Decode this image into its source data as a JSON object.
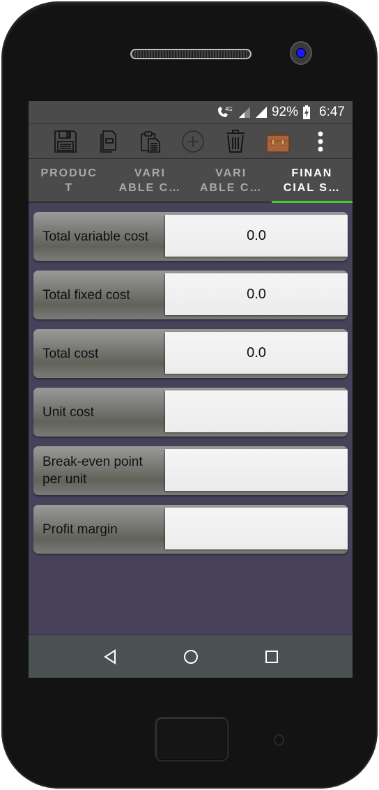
{
  "device": {
    "frame_color": "#131313",
    "camera_color": "#1a1aff"
  },
  "status_bar": {
    "network": "4G",
    "battery_percent": "92%",
    "time": "6:47",
    "icons": [
      "call-4g-icon",
      "signal-weak-icon",
      "signal-full-icon",
      "battery-charging-icon"
    ]
  },
  "toolbar": {
    "buttons": [
      {
        "name": "save",
        "icon": "floppy-disk-icon"
      },
      {
        "name": "copy",
        "icon": "copy-document-icon"
      },
      {
        "name": "paste",
        "icon": "clipboard-paste-icon"
      },
      {
        "name": "add",
        "icon": "plus-circle-icon"
      },
      {
        "name": "delete",
        "icon": "trash-icon"
      },
      {
        "name": "briefcase",
        "icon": "briefcase-icon"
      },
      {
        "name": "more",
        "icon": "more-vertical-icon"
      }
    ]
  },
  "tabs": [
    {
      "line1": "PRODUC",
      "line2": "T",
      "active": false
    },
    {
      "line1": "VARI",
      "line2": "ABLE C…",
      "active": false
    },
    {
      "line1": "VARI",
      "line2": "ABLE C…",
      "active": false
    },
    {
      "line1": "FINAN",
      "line2": "CIAL S…",
      "active": true
    }
  ],
  "accent_color": "#3ccf2e",
  "financial_summary": {
    "rows": [
      {
        "label": "Total variable cost",
        "value": "0.0"
      },
      {
        "label": "Total fixed cost",
        "value": "0.0"
      },
      {
        "label": "Total cost",
        "value": "0.0"
      },
      {
        "label": "Unit cost",
        "value": ""
      },
      {
        "label": "Break-even point per unit",
        "value": ""
      },
      {
        "label": "Profit margin",
        "value": ""
      }
    ]
  },
  "nav_bar": {
    "buttons": [
      "back-icon",
      "home-icon",
      "recents-icon"
    ]
  }
}
